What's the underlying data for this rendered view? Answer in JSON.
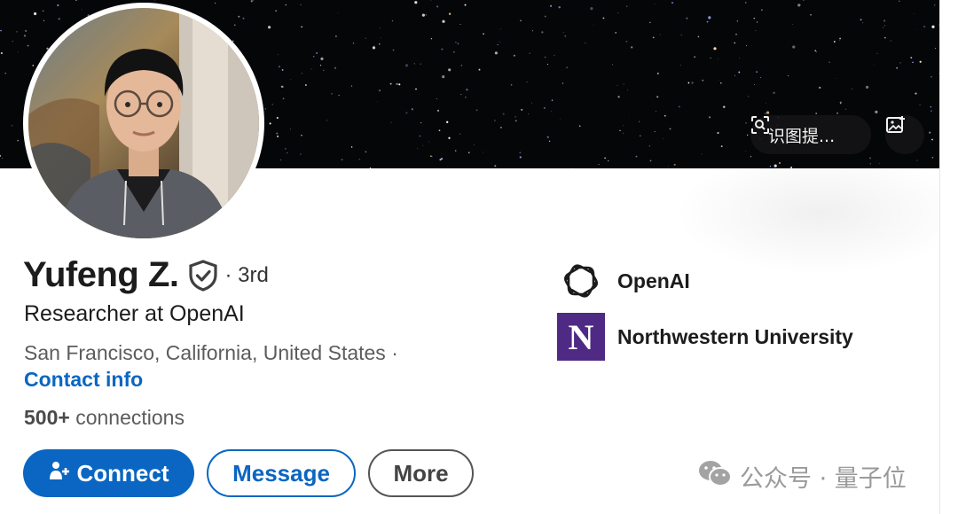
{
  "cover": {
    "scan_button_label": "识图提...",
    "scan_icon": "scan-image-icon",
    "edit_icon": "edit-cover-photo-icon"
  },
  "profile": {
    "avatar_icon": "profile-photo",
    "name": "Yufeng Z.",
    "verified_icon": "verified-shield-icon",
    "degree": "· 3rd",
    "headline": "Researcher at OpenAI",
    "location": "San Francisco, California, United States ·",
    "contact_label": "Contact info",
    "connections_count": "500+",
    "connections_label": " connections"
  },
  "actions": {
    "connect_label": "Connect",
    "connect_icon": "add-person-icon",
    "message_label": "Message",
    "more_label": "More"
  },
  "organizations": [
    {
      "name": "OpenAI",
      "logo": "openai-logo"
    },
    {
      "name": "Northwestern University",
      "logo": "northwestern-logo",
      "logo_letter": "N"
    }
  ],
  "watermark": {
    "text": "公众号 · 量子位",
    "icon": "wechat-icon"
  },
  "colors": {
    "accent": "#0a66c2",
    "cover": "#050608",
    "northwestern_purple": "#4e2a84"
  }
}
